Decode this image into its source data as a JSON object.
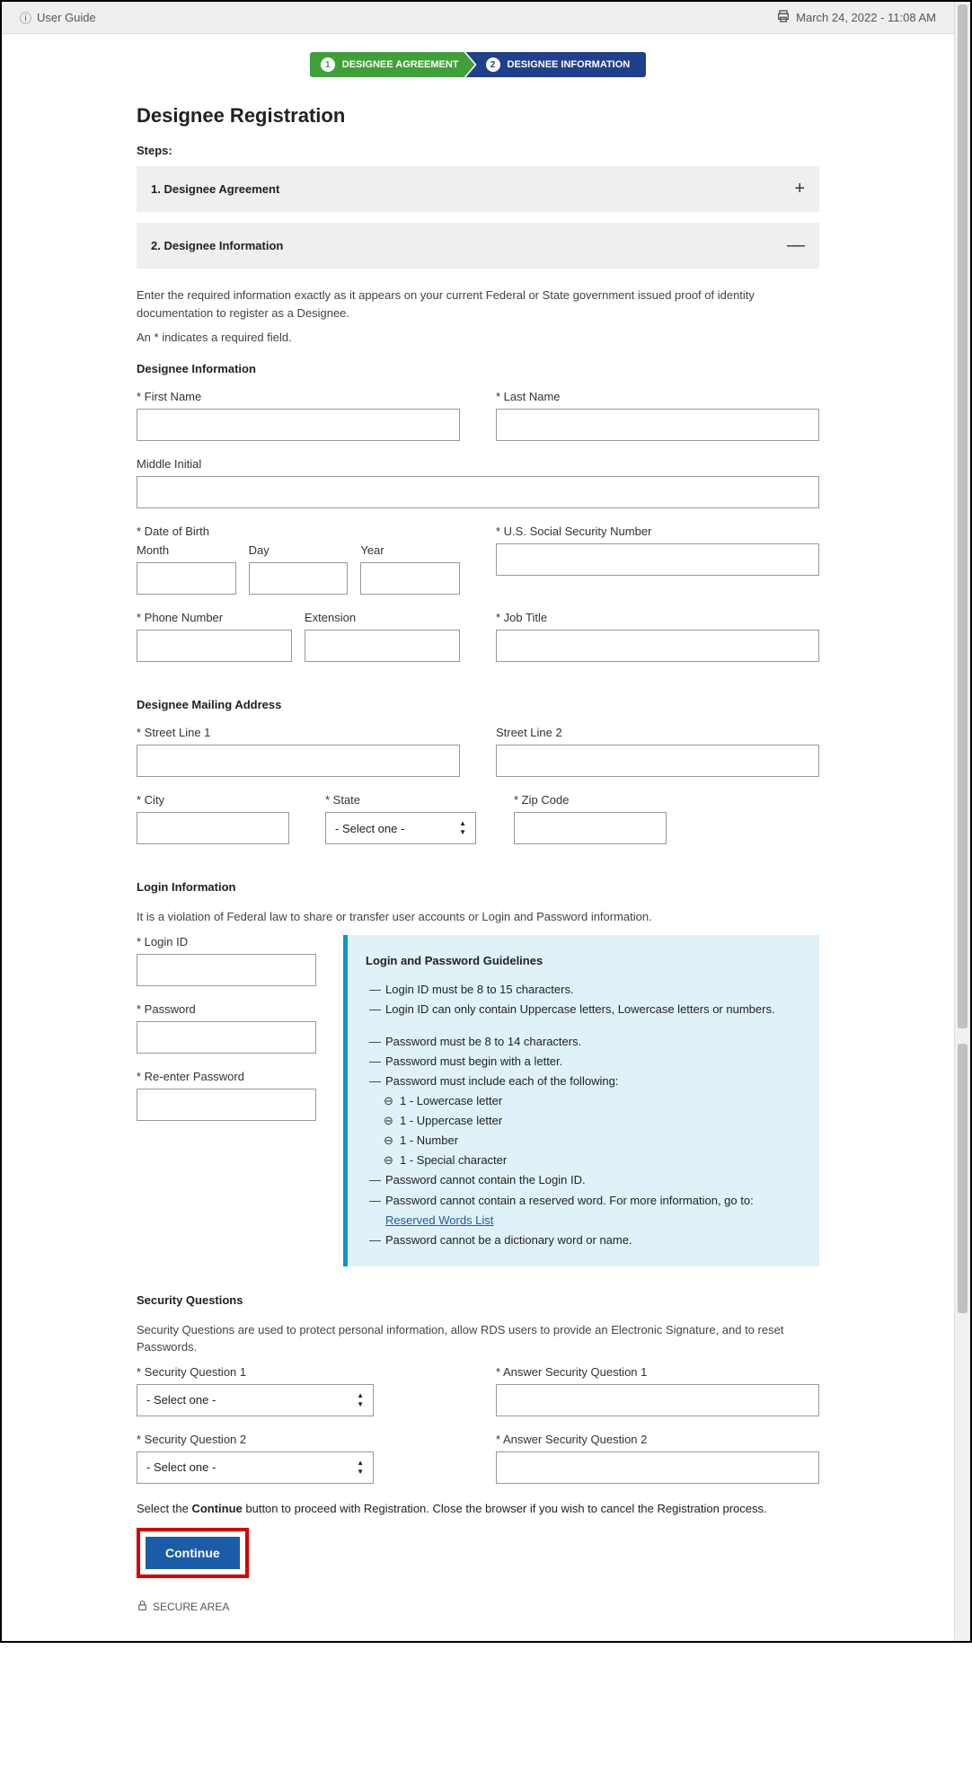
{
  "topbar": {
    "user_guide": "User Guide",
    "timestamp": "March 24, 2022 - 11:08 AM"
  },
  "stepper": {
    "step1": "DESIGNEE AGREEMENT",
    "step2": "DESIGNEE INFORMATION"
  },
  "page_title": "Designee Registration",
  "steps_label": "Steps:",
  "accordion": {
    "item1": "1. Designee Agreement",
    "item2": "2. Designee Information"
  },
  "intro_text": "Enter the required information exactly as it appears on your current Federal or State government issued proof of identity documentation to register as a Designee.",
  "req_note_prefix": "An ",
  "req_note_suffix": " indicates a required field.",
  "sections": {
    "designee_info": "Designee Information",
    "mailing": "Designee Mailing Address",
    "login": "Login Information",
    "security": "Security Questions"
  },
  "labels": {
    "first_name": "First Name",
    "last_name": "Last Name",
    "middle_initial": "Middle Initial",
    "dob": "Date of Birth",
    "month": "Month",
    "day": "Day",
    "year": "Year",
    "ssn": "U.S. Social Security Number",
    "phone": "Phone Number",
    "extension": "Extension",
    "job_title": "Job Title",
    "street1": "Street Line 1",
    "street2": "Street Line 2",
    "city": "City",
    "state": "State",
    "zip": "Zip Code",
    "login_id": "Login ID",
    "password": "Password",
    "reenter_password": "Re-enter Password",
    "sq1": "Security Question 1",
    "aq1": "Answer Security Question 1",
    "sq2": "Security Question 2",
    "aq2": "Answer Security Question 2"
  },
  "select_placeholder": "- Select one -",
  "login_law_note": "It is a violation of Federal law to share or transfer user accounts or Login and Password information.",
  "guidelines": {
    "title": "Login and Password Guidelines",
    "g1": "Login ID must be 8 to 15 characters.",
    "g2": "Login ID can only contain Uppercase letters, Lowercase letters or numbers.",
    "g3": "Password must be 8 to 14 characters.",
    "g4": "Password must begin with a letter.",
    "g5": "Password must include each of the following:",
    "g5a": "1 - Lowercase letter",
    "g5b": "1 - Uppercase letter",
    "g5c": "1 - Number",
    "g5d": "1 - Special character",
    "g6": "Password cannot contain the Login ID.",
    "g7_pre": "Password cannot contain a reserved word. For more information, go to: ",
    "g7_link": "Reserved Words List",
    "g8": "Password cannot be a dictionary word or name."
  },
  "security_intro": "Security Questions are used to protect personal information, allow RDS users to provide an Electronic Signature, and to reset Passwords.",
  "continue_note_pre": "Select the ",
  "continue_note_bold": "Continue",
  "continue_note_post": " button to proceed with Registration. Close the browser if you wish to cancel the Registration process.",
  "continue_btn": "Continue",
  "secure_area": "SECURE AREA"
}
